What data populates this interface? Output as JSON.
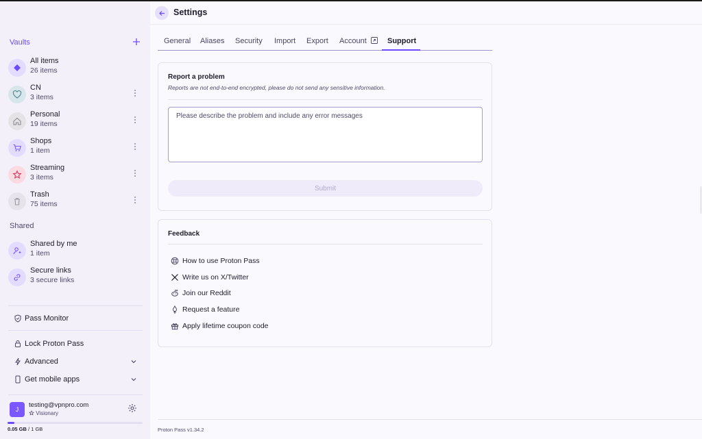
{
  "sidebar": {
    "vaults_title": "Vaults",
    "vaults": [
      {
        "name": "All items",
        "count": "26 items",
        "icon": "diamond-icon",
        "color": "#6d4aff",
        "bg": "#e4dcff"
      },
      {
        "name": "CN",
        "count": "3 items",
        "icon": "heart-icon",
        "color": "#5b8a93",
        "bg": "#d6e6ea"
      },
      {
        "name": "Personal",
        "count": "19 items",
        "icon": "home-icon",
        "color": "#8d8a90",
        "bg": "#e5e3e6"
      },
      {
        "name": "Shops",
        "count": "1 item",
        "icon": "cart-icon",
        "color": "#7a57ff",
        "bg": "#e3dcff"
      },
      {
        "name": "Streaming",
        "count": "3 items",
        "icon": "star-icon",
        "color": "#d6365d",
        "bg": "#fbdbe2"
      },
      {
        "name": "Trash",
        "count": "75 items",
        "icon": "trash-icon",
        "color": "#9b98a3",
        "bg": "#e6e4ea"
      }
    ],
    "shared_title": "Shared",
    "shared": [
      {
        "name": "Shared by me",
        "count": "1 item",
        "icon": "user-share-icon"
      },
      {
        "name": "Secure links",
        "count": "3 secure links",
        "icon": "link-icon"
      }
    ],
    "menu": {
      "pass_monitor": "Pass Monitor",
      "lock": "Lock Proton Pass",
      "advanced": "Advanced",
      "mobile": "Get mobile apps"
    },
    "user": {
      "initial": "J",
      "email": "testing@vpnpro.com",
      "plan": "Visionary"
    },
    "storage": {
      "used": "0.05 GB",
      "total": "/ 1 GB",
      "fraction": 0.05
    }
  },
  "header": {
    "title": "Settings"
  },
  "tabs": [
    {
      "label": "General",
      "active": false
    },
    {
      "label": "Aliases",
      "active": false
    },
    {
      "label": "Security",
      "active": false
    },
    {
      "label": "Import",
      "active": false
    },
    {
      "label": "Export",
      "active": false
    },
    {
      "label": "Account",
      "active": false
    },
    {
      "label": "Support",
      "active": true
    }
  ],
  "report": {
    "title": "Report a problem",
    "subtitle": "Reports are not end-to-end encrypted, please do not send any sensitive information.",
    "placeholder": "Please describe the problem and include any error messages",
    "submit": "Submit"
  },
  "feedback": {
    "title": "Feedback",
    "items": [
      {
        "label": "How to use Proton Pass",
        "icon": "lifebuoy-icon"
      },
      {
        "label": "Write us on X/Twitter",
        "icon": "x-twitter-icon"
      },
      {
        "label": "Join our Reddit",
        "icon": "reddit-icon"
      },
      {
        "label": "Request a feature",
        "icon": "bulb-icon"
      },
      {
        "label": "Apply lifetime coupon code",
        "icon": "gift-icon"
      }
    ]
  },
  "footer": {
    "version": "Proton Pass v1.34.2"
  },
  "colors": {
    "accent": "#6d4aff",
    "sidebar_bg": "#f3f0fa",
    "main_bg": "#faf9fe"
  }
}
